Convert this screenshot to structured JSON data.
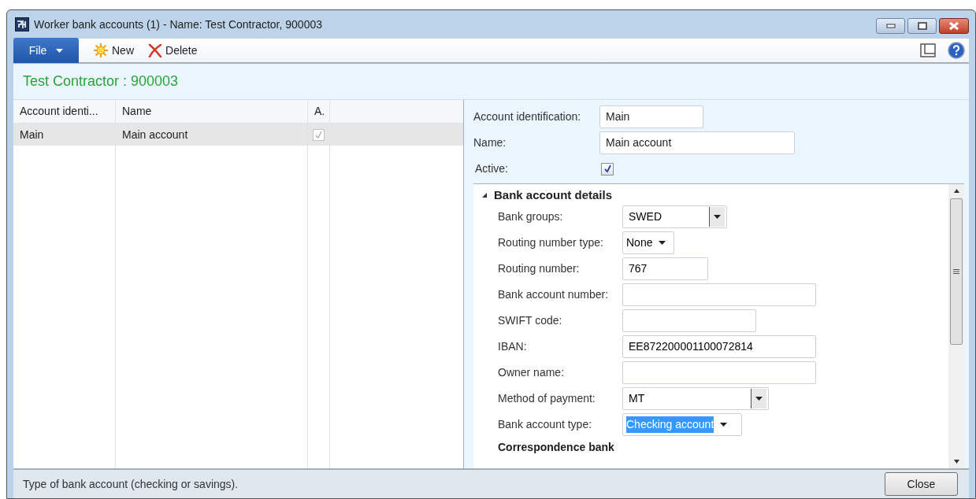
{
  "window": {
    "title": "Worker bank accounts (1) - Name: Test Contractor, 900003"
  },
  "toolbar": {
    "file_menu": "File",
    "buttons": [
      {
        "kind": "new",
        "label": "New"
      },
      {
        "kind": "delete",
        "label": "Delete"
      }
    ]
  },
  "header": {
    "title": "Test Contractor : 900003"
  },
  "grid": {
    "columns": [
      "Account identi...",
      "Name",
      "A."
    ],
    "rows": [
      {
        "account_id": "Main",
        "name": "Main account",
        "active": true,
        "selected": true
      }
    ]
  },
  "details": {
    "account_identification": {
      "label": "Account identification:",
      "value": "Main"
    },
    "name": {
      "label": "Name:",
      "value": "Main account"
    },
    "active": {
      "label": "Active:",
      "checked": true
    }
  },
  "bank_section": {
    "title": "Bank account details",
    "expanded": true,
    "fields": [
      {
        "kind": "combo",
        "label": "Bank groups:",
        "value": "SWED"
      },
      {
        "kind": "dropdown",
        "label": "Routing number type:",
        "value": "None"
      },
      {
        "kind": "text",
        "label": "Routing number:",
        "value": "767"
      },
      {
        "kind": "text",
        "label": "Bank account number:"
      },
      {
        "kind": "text",
        "label": "SWIFT code:"
      },
      {
        "kind": "text",
        "label": "IBAN:",
        "value": "EE872200001100072814"
      },
      {
        "kind": "text",
        "label": "Owner name:"
      },
      {
        "kind": "combo",
        "label": "Method of payment:",
        "value": "MT"
      },
      {
        "kind": "dropdown",
        "label": "Bank account type:",
        "value": "Checking account",
        "selected": true
      }
    ],
    "subheading": "Correspondence bank"
  },
  "status_bar": {
    "text": "Type of bank account (checking or savings).",
    "close_button": "Close"
  }
}
